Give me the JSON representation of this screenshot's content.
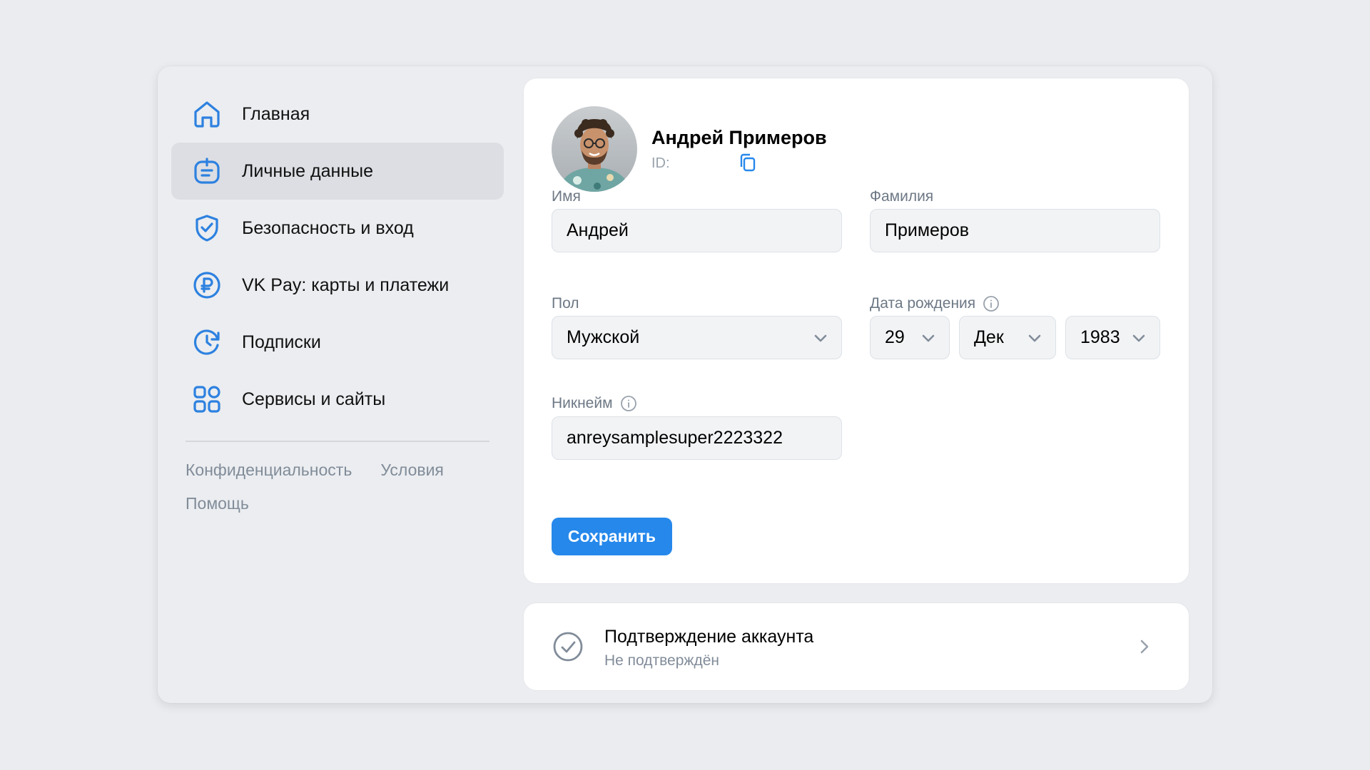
{
  "sidebar": {
    "items": [
      {
        "label": "Главная",
        "icon": "home-icon"
      },
      {
        "label": "Личные данные",
        "icon": "personal-data-icon",
        "active": true
      },
      {
        "label": "Безопасность и вход",
        "icon": "shield-check-icon"
      },
      {
        "label": "VK Pay: карты и платежи",
        "icon": "ruble-icon"
      },
      {
        "label": "Подписки",
        "icon": "subscriptions-icon"
      },
      {
        "label": "Сервисы и сайты",
        "icon": "services-grid-icon"
      }
    ],
    "footer_links": {
      "privacy": "Конфиденциальность",
      "terms": "Условия",
      "help": "Помощь"
    }
  },
  "profile": {
    "name": "Андрей Примеров",
    "id_label": "ID:"
  },
  "form": {
    "first_name": {
      "label": "Имя",
      "value": "Андрей"
    },
    "last_name": {
      "label": "Фамилия",
      "value": "Примеров"
    },
    "gender": {
      "label": "Пол",
      "value": "Мужской"
    },
    "birth_date": {
      "label": "Дата рождения",
      "day": "29",
      "month": "Дек",
      "year": "1983"
    },
    "nickname": {
      "label": "Никнейм",
      "value": "anreysamplesuper2223322"
    },
    "save_label": "Сохранить"
  },
  "verification": {
    "title": "Подтверждение аккаунта",
    "status": "Не подтверждён"
  },
  "colors": {
    "accent": "#2688eb",
    "icon_blue": "#2d81e0",
    "active_bg": "#dcdee3"
  }
}
